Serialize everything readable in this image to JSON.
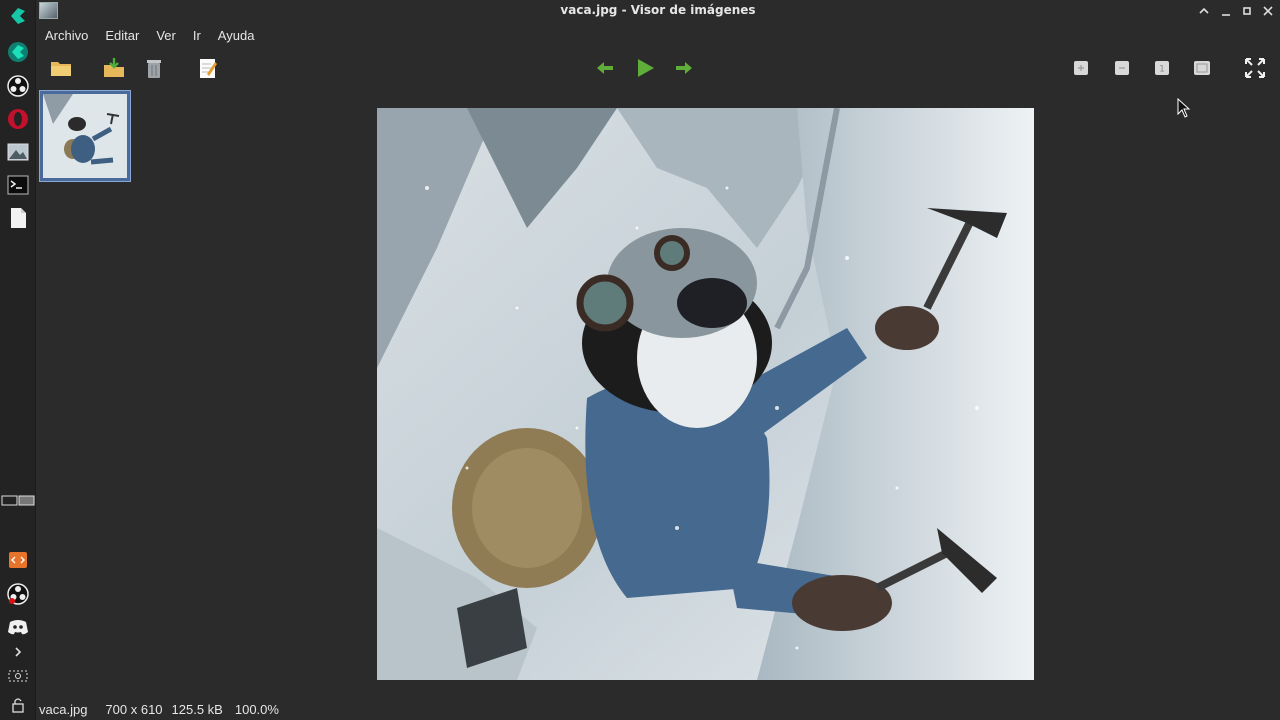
{
  "window": {
    "title": "vaca.jpg - Visor de imágenes"
  },
  "menu": {
    "items": [
      "Archivo",
      "Editar",
      "Ver",
      "Ir",
      "Ayuda"
    ]
  },
  "toolbar": {
    "left": [
      "open-folder-icon",
      "save-icon",
      "trash-icon",
      "edit-icon"
    ],
    "center": [
      "back-arrow-icon",
      "play-icon",
      "forward-arrow-icon"
    ],
    "right": [
      "zoom-in-icon",
      "zoom-out-icon",
      "zoom-fit-icon",
      "zoom-100-icon",
      "fullscreen-icon"
    ]
  },
  "thumbnails": [
    {
      "name": "vaca.jpg",
      "selected": true
    }
  ],
  "status": {
    "filename": "vaca.jpg",
    "dimensions": "700 x 610",
    "filesize": "125.5 kB",
    "zoom": "100.0%"
  },
  "colors": {
    "accent_green": "#5fae3a",
    "selection_blue": "#4a6a9b"
  }
}
